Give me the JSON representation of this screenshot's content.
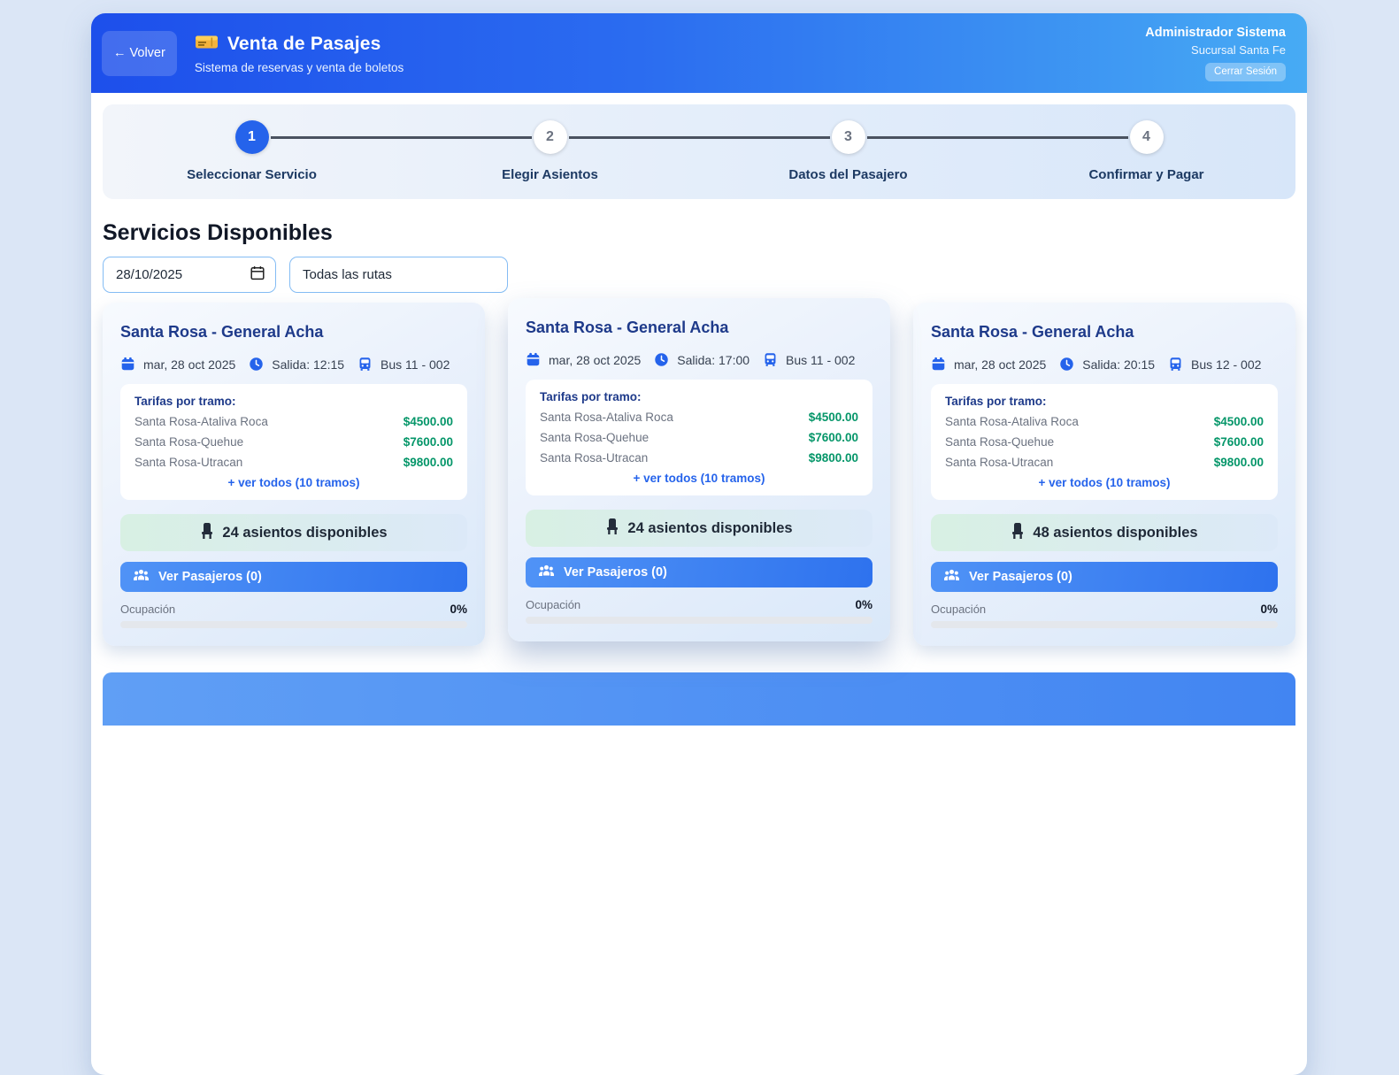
{
  "header": {
    "back_label": "← Volver",
    "title": "Venta de Pasajes",
    "subtitle": "Sistema de reservas y venta de boletos",
    "user_name": "Administrador Sistema",
    "branch": "Sucursal Santa Fe",
    "logout_label": "Cerrar Sesión"
  },
  "stepper": {
    "steps": [
      {
        "number": "1",
        "label": "Seleccionar Servicio",
        "active": true
      },
      {
        "number": "2",
        "label": "Elegir Asientos",
        "active": false
      },
      {
        "number": "3",
        "label": "Datos del Pasajero",
        "active": false
      },
      {
        "number": "4",
        "label": "Confirmar y Pagar",
        "active": false
      }
    ]
  },
  "services_section": {
    "title": "Servicios Disponibles",
    "date_filter_value": "28/10/2025",
    "route_filter_value": "Todas las rutas"
  },
  "services": [
    {
      "route": "Santa Rosa - General Acha",
      "date": "mar, 28 oct 2025",
      "departure": "Salida: 12:15",
      "bus": "Bus 11 - 002",
      "fares_title": "Tarifas por tramo:",
      "fares": [
        {
          "segment": "Santa Rosa-Ataliva Roca",
          "price": "$4500.00"
        },
        {
          "segment": "Santa Rosa-Quehue",
          "price": "$7600.00"
        },
        {
          "segment": "Santa Rosa-Utracan",
          "price": "$9800.00"
        }
      ],
      "see_all": "+ ver todos (10 tramos)",
      "seats": "24 asientos disponibles",
      "passengers": "Ver Pasajeros (0)",
      "occupancy_label": "Ocupación",
      "occupancy_pct": "0%",
      "occupancy_value": 0,
      "highlighted": false
    },
    {
      "route": "Santa Rosa - General Acha",
      "date": "mar, 28 oct 2025",
      "departure": "Salida: 17:00",
      "bus": "Bus 11 - 002",
      "fares_title": "Tarifas por tramo:",
      "fares": [
        {
          "segment": "Santa Rosa-Ataliva Roca",
          "price": "$4500.00"
        },
        {
          "segment": "Santa Rosa-Quehue",
          "price": "$7600.00"
        },
        {
          "segment": "Santa Rosa-Utracan",
          "price": "$9800.00"
        }
      ],
      "see_all": "+ ver todos (10 tramos)",
      "seats": "24 asientos disponibles",
      "passengers": "Ver Pasajeros (0)",
      "occupancy_label": "Ocupación",
      "occupancy_pct": "0%",
      "occupancy_value": 0,
      "highlighted": true
    },
    {
      "route": "Santa Rosa - General Acha",
      "date": "mar, 28 oct 2025",
      "departure": "Salida: 20:15",
      "bus": "Bus 12 - 002",
      "fares_title": "Tarifas por tramo:",
      "fares": [
        {
          "segment": "Santa Rosa-Ataliva Roca",
          "price": "$4500.00"
        },
        {
          "segment": "Santa Rosa-Quehue",
          "price": "$7600.00"
        },
        {
          "segment": "Santa Rosa-Utracan",
          "price": "$9800.00"
        }
      ],
      "see_all": "+ ver todos (10 tramos)",
      "seats": "48 asientos disponibles",
      "passengers": "Ver Pasajeros (0)",
      "occupancy_label": "Ocupación",
      "occupancy_pct": "0%",
      "occupancy_value": 0,
      "highlighted": false
    }
  ]
}
